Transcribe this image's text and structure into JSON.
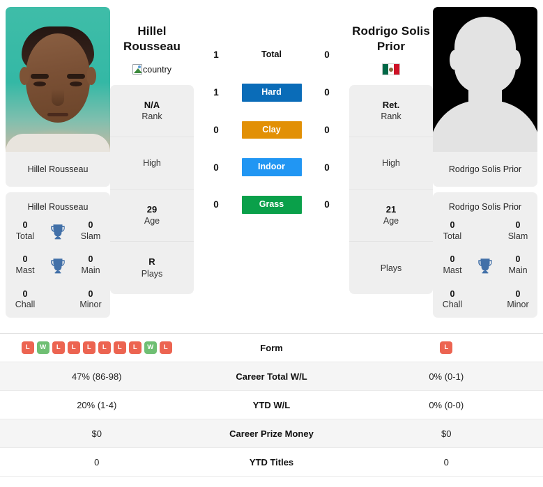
{
  "players": {
    "left": {
      "name": "Hillel Rousseau",
      "name_line1": "Hillel",
      "name_line2": "Rousseau",
      "photo_caption": "Hillel Rousseau",
      "flag_alt": "country",
      "flag_type": "broken-image",
      "photo_type": "player-photo",
      "info": [
        {
          "value": "N/A",
          "label": "Rank"
        },
        {
          "value": "",
          "label": "High"
        },
        {
          "value": "29",
          "label": "Age"
        },
        {
          "value": "R",
          "label": "Plays"
        }
      ],
      "titles": {
        "header": "Hillel Rousseau",
        "cells": [
          {
            "value": "0",
            "label": "Total"
          },
          {
            "value": "0",
            "label": "Slam"
          },
          {
            "value": "0",
            "label": "Mast"
          },
          {
            "value": "0",
            "label": "Main"
          },
          {
            "value": "0",
            "label": "Chall"
          },
          {
            "value": "0",
            "label": "Minor"
          }
        ]
      },
      "stats": {
        "form": [
          "L",
          "W",
          "L",
          "L",
          "L",
          "L",
          "L",
          "L",
          "W",
          "L"
        ],
        "career_total_wl": "47% (86-98)",
        "ytd_wl": "20% (1-4)",
        "career_prize_money": "$0",
        "ytd_titles": "0"
      }
    },
    "right": {
      "name": "Rodrigo Solis Prior",
      "name_line1": "Rodrigo Solis",
      "name_line2": "Prior",
      "photo_caption": "Rodrigo Solis Prior",
      "flag_alt": "Mexico",
      "flag_type": "mexico-flag",
      "photo_type": "silhouette-placeholder",
      "info": [
        {
          "value": "Ret.",
          "label": "Rank"
        },
        {
          "value": "",
          "label": "High"
        },
        {
          "value": "21",
          "label": "Age"
        },
        {
          "value": "",
          "label": "Plays"
        }
      ],
      "titles": {
        "header": "Rodrigo Solis Prior",
        "cells": [
          {
            "value": "0",
            "label": "Total"
          },
          {
            "value": "0",
            "label": "Slam"
          },
          {
            "value": "0",
            "label": "Mast"
          },
          {
            "value": "0",
            "label": "Main"
          },
          {
            "value": "0",
            "label": "Chall"
          },
          {
            "value": "0",
            "label": "Minor"
          }
        ]
      },
      "stats": {
        "form": [
          "L"
        ],
        "career_total_wl": "0% (0-1)",
        "ytd_wl": "0% (0-0)",
        "career_prize_money": "$0",
        "ytd_titles": "0"
      }
    }
  },
  "head_to_head": {
    "rows": [
      {
        "label": "Total",
        "left": "1",
        "right": "0",
        "color": "",
        "plain": true
      },
      {
        "label": "Hard",
        "left": "1",
        "right": "0",
        "color": "#0a6cb8",
        "plain": false
      },
      {
        "label": "Clay",
        "left": "0",
        "right": "0",
        "color": "#e29005",
        "plain": false
      },
      {
        "label": "Indoor",
        "left": "0",
        "right": "0",
        "color": "#2196f3",
        "plain": false
      },
      {
        "label": "Grass",
        "left": "0",
        "right": "0",
        "color": "#0aa04a",
        "plain": false
      }
    ]
  },
  "stats_table": {
    "rows": [
      {
        "label": "Form",
        "type": "form",
        "left": "",
        "right": ""
      },
      {
        "label": "Career Total W/L",
        "type": "text",
        "left": "47% (86-98)",
        "right": "0% (0-1)"
      },
      {
        "label": "YTD W/L",
        "type": "text",
        "left": "20% (1-4)",
        "right": "0% (0-0)"
      },
      {
        "label": "Career Prize Money",
        "type": "text",
        "left": "$0",
        "right": "$0"
      },
      {
        "label": "YTD Titles",
        "type": "text",
        "left": "0",
        "right": "0"
      }
    ]
  },
  "colors": {
    "hard": "#0a6cb8",
    "clay": "#e29005",
    "indoor": "#2196f3",
    "grass": "#0aa04a",
    "loss_badge": "#ec6451",
    "win_badge": "#6fbf73",
    "card_bg": "#efefef",
    "trophy": "#4270a8"
  }
}
